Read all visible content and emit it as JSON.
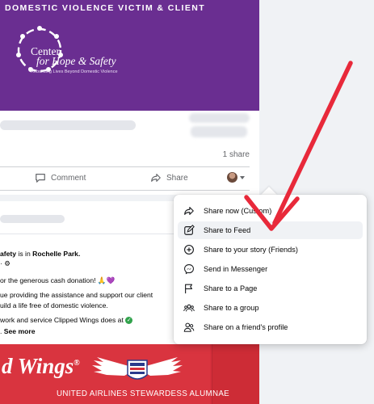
{
  "post1": {
    "banner_text": "DOMESTIC VIOLENCE VICTIM & CLIENT",
    "logo_line1": "Center",
    "logo_line2": "for Hope & Safety",
    "logo_tagline": "Rebuilding Lives Beyond Domestic Violence",
    "share_count": "1 share",
    "comment_label": "Comment",
    "share_label": "Share"
  },
  "post2": {
    "location_name": "afety",
    "location_mid": " is in ",
    "location_place": "Rochelle Park.",
    "meta": "· ⚙",
    "line1": "or the generous cash donation! 🙏💜",
    "line2": "ue providing the assistance and support our client",
    "line3": "uild a life free of domestic violence.",
    "line4": " work and service Clipped Wings does at ",
    "see_more_prefix": ". ",
    "see_more": "See more",
    "image_title": "d Wings",
    "image_reg": "®",
    "image_subtitle": "UNITED AIRLINES STEWARDESS ALUMNAE"
  },
  "share_menu": {
    "items": [
      {
        "label": "Share now (Custom)",
        "icon": "share-arrow-icon"
      },
      {
        "label": "Share to Feed",
        "icon": "pencil-square-icon"
      },
      {
        "label": "Share to your story (Friends)",
        "icon": "plus-circle-icon"
      },
      {
        "label": "Send in Messenger",
        "icon": "messenger-icon"
      },
      {
        "label": "Share to a Page",
        "icon": "flag-icon"
      },
      {
        "label": "Share to a group",
        "icon": "group-icon"
      },
      {
        "label": "Share on a friend's profile",
        "icon": "friend-profile-icon"
      }
    ],
    "hovered_index": 1
  },
  "colors": {
    "banner_purple": "#6a2e91",
    "image_red": "#d62f3b",
    "annotation_arrow": "#e8293a",
    "menu_hover": "#f0f2f5"
  }
}
